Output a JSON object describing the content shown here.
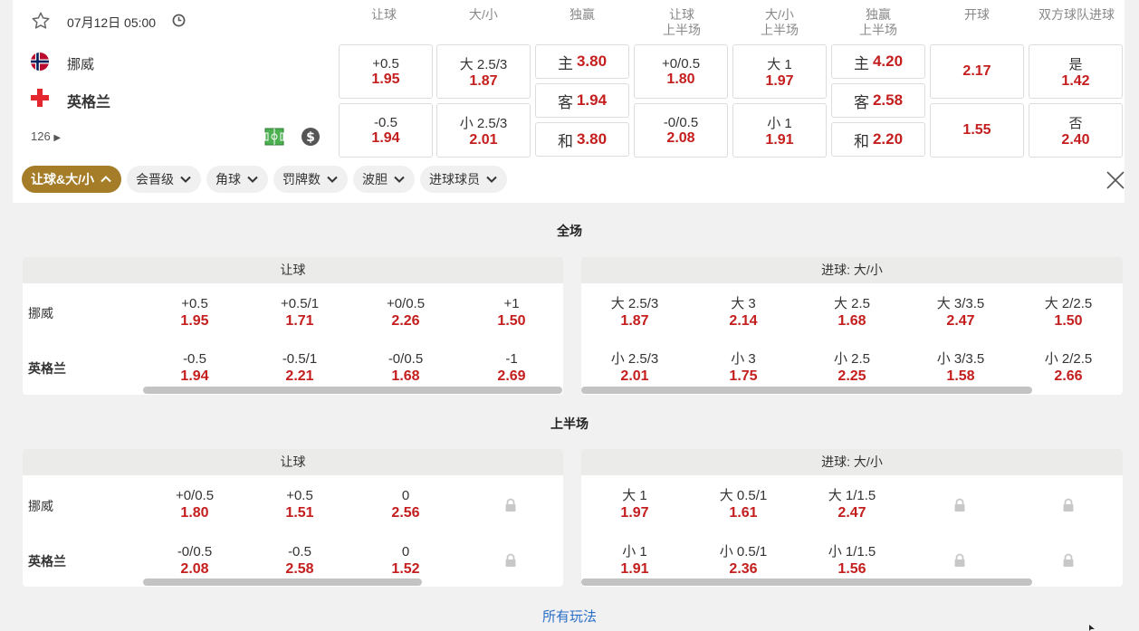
{
  "match": {
    "datetime": "07月12日 05:00",
    "home": "挪威",
    "away": "英格兰",
    "more_count": "126"
  },
  "headers": [
    {
      "l1": "让球",
      "l2": ""
    },
    {
      "l1": "大/小",
      "l2": ""
    },
    {
      "l1": "独赢",
      "l2": ""
    },
    {
      "l1": "让球",
      "l2": "上半场"
    },
    {
      "l1": "大/小",
      "l2": "上半场"
    },
    {
      "l1": "独赢",
      "l2": "上半场"
    },
    {
      "l1": "开球",
      "l2": ""
    },
    {
      "l1": "双方球队进球",
      "l2": ""
    }
  ],
  "top_odds": {
    "hdp_home": {
      "label": "+0.5",
      "odd": "1.95"
    },
    "hdp_away": {
      "label": "-0.5",
      "odd": "1.94"
    },
    "ou_over": {
      "label": "大 2.5/3",
      "odd": "1.87"
    },
    "ou_under": {
      "label": "小 2.5/3",
      "odd": "2.01"
    },
    "x1_home": {
      "label": "主",
      "odd": "3.80"
    },
    "x1_away": {
      "label": "客",
      "odd": "1.94"
    },
    "x1_draw": {
      "label": "和",
      "odd": "3.80"
    },
    "h1_hdp_home": {
      "label": "+0/0.5",
      "odd": "1.80"
    },
    "h1_hdp_away": {
      "label": "-0/0.5",
      "odd": "2.08"
    },
    "h1_ou_over": {
      "label": "大 1",
      "odd": "1.97"
    },
    "h1_ou_under": {
      "label": "小 1",
      "odd": "1.91"
    },
    "h1_x1_home": {
      "label": "主",
      "odd": "4.20"
    },
    "h1_x1_away": {
      "label": "客",
      "odd": "2.58"
    },
    "h1_x1_draw": {
      "label": "和",
      "odd": "2.20"
    },
    "kickoff_1": {
      "odd": "2.17"
    },
    "kickoff_2": {
      "odd": "1.55"
    },
    "btts_yes": {
      "label": "是",
      "odd": "1.42"
    },
    "btts_no": {
      "label": "否",
      "odd": "2.40"
    }
  },
  "filters": [
    "让球&大/小",
    "会晋级",
    "角球",
    "罚牌数",
    "波胆",
    "进球球员"
  ],
  "full": {
    "title": "全场",
    "hdp_title": "让球",
    "ou_title": "进球: 大/小",
    "hdp_home": [
      {
        "label": "+0.5",
        "odd": "1.95"
      },
      {
        "label": "+0.5/1",
        "odd": "1.71"
      },
      {
        "label": "+0/0.5",
        "odd": "2.26"
      },
      {
        "label": "+1",
        "odd": "1.50"
      }
    ],
    "hdp_away": [
      {
        "label": "-0.5",
        "odd": "1.94"
      },
      {
        "label": "-0.5/1",
        "odd": "2.21"
      },
      {
        "label": "-0/0.5",
        "odd": "1.68"
      },
      {
        "label": "-1",
        "odd": "2.69"
      }
    ],
    "ou_over": [
      {
        "label": "大 2.5/3",
        "odd": "1.87"
      },
      {
        "label": "大 3",
        "odd": "2.14"
      },
      {
        "label": "大 2.5",
        "odd": "1.68"
      },
      {
        "label": "大 3/3.5",
        "odd": "2.47"
      },
      {
        "label": "大 2/2.5",
        "odd": "1.50"
      }
    ],
    "ou_under": [
      {
        "label": "小 2.5/3",
        "odd": "2.01"
      },
      {
        "label": "小 3",
        "odd": "1.75"
      },
      {
        "label": "小 2.5",
        "odd": "2.25"
      },
      {
        "label": "小 3/3.5",
        "odd": "1.58"
      },
      {
        "label": "小 2/2.5",
        "odd": "2.66"
      }
    ]
  },
  "half": {
    "title": "上半场",
    "hdp_title": "让球",
    "ou_title": "进球: 大/小",
    "hdp_home": [
      {
        "label": "+0/0.5",
        "odd": "1.80"
      },
      {
        "label": "+0.5",
        "odd": "1.51"
      },
      {
        "label": "0",
        "odd": "2.56"
      }
    ],
    "hdp_away": [
      {
        "label": "-0/0.5",
        "odd": "2.08"
      },
      {
        "label": "-0.5",
        "odd": "2.58"
      },
      {
        "label": "0",
        "odd": "1.52"
      }
    ],
    "ou_over": [
      {
        "label": "大 1",
        "odd": "1.97"
      },
      {
        "label": "大 0.5/1",
        "odd": "1.61"
      },
      {
        "label": "大 1/1.5",
        "odd": "2.47"
      }
    ],
    "ou_under": [
      {
        "label": "小 1",
        "odd": "1.91"
      },
      {
        "label": "小 0.5/1",
        "odd": "2.36"
      },
      {
        "label": "小 1/1.5",
        "odd": "1.56"
      }
    ]
  },
  "all_markets_link": "所有玩法",
  "colors": {
    "accent": "#a57c28",
    "odds": "#c41e1e",
    "link": "#2a6fc9"
  }
}
